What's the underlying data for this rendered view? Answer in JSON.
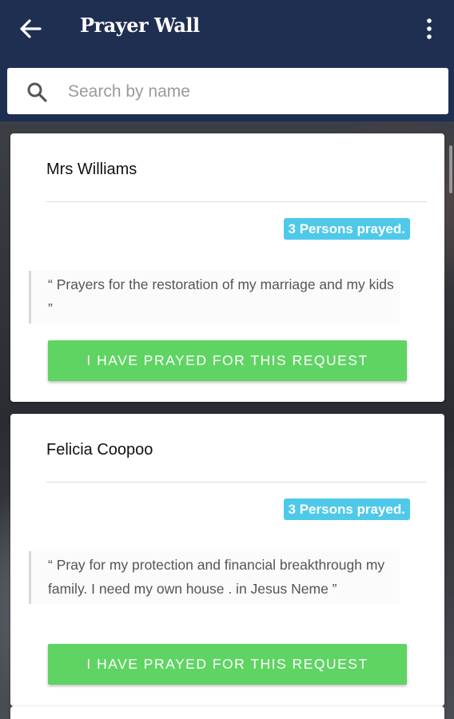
{
  "header": {
    "title": "Prayer Wall",
    "back_icon": "arrow-left-icon",
    "menu_icon": "more-vertical-icon",
    "background": "#1f2f52"
  },
  "search": {
    "placeholder": "Search by name",
    "value": "",
    "icon": "search-icon"
  },
  "requests": [
    {
      "name": "Mrs Williams",
      "prayed_badge": "3 Persons prayed.",
      "request_text": "“ Prayers for the restoration of my marriage and my kids ”",
      "button_label": "I HAVE PRAYED FOR THIS REQUEST"
    },
    {
      "name": "Felicia Coopoo",
      "prayed_badge": "3 Persons prayed.",
      "request_text": "“ Pray for my protection and financial breakthrough my family. I need my own house . in Jesus Neme ”",
      "button_label": "I HAVE PRAYED FOR THIS REQUEST"
    }
  ],
  "colors": {
    "accent_badge": "#4ec9ea",
    "pray_button": "#5fd463"
  }
}
